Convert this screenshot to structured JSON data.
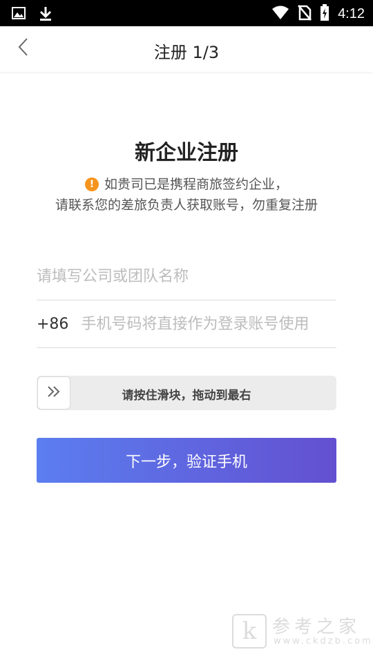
{
  "status_bar": {
    "time": "4:12",
    "icons": [
      "image-icon",
      "download-icon",
      "wifi-icon",
      "no-sim-icon",
      "battery-charging-icon"
    ]
  },
  "header": {
    "title": "注册 1/3",
    "back_icon": "chevron-left-icon"
  },
  "main": {
    "heading": "新企业注册",
    "notice_icon": "warning-icon",
    "notice_line1": "如贵司已是携程商旅签约企业，",
    "notice_line2": "请联系您的差旅负责人获取账号，勿重复注册"
  },
  "form": {
    "company_placeholder": "请填写公司或团队名称",
    "company_value": "",
    "phone_prefix": "+86",
    "phone_placeholder": "手机号码将直接作为登录账号使用",
    "phone_value": "",
    "slider_text": "请按住滑块，拖动到最右",
    "slider_icon": "double-chevron-right-icon",
    "next_button": "下一步，验证手机"
  },
  "colors": {
    "button_gradient_start": "#5b7ef0",
    "button_gradient_end": "#6350d0",
    "warning": "#f5941d"
  },
  "watermark": {
    "logo_letter": "k",
    "title": "参考之家",
    "url": "www.ckdzb.com"
  }
}
